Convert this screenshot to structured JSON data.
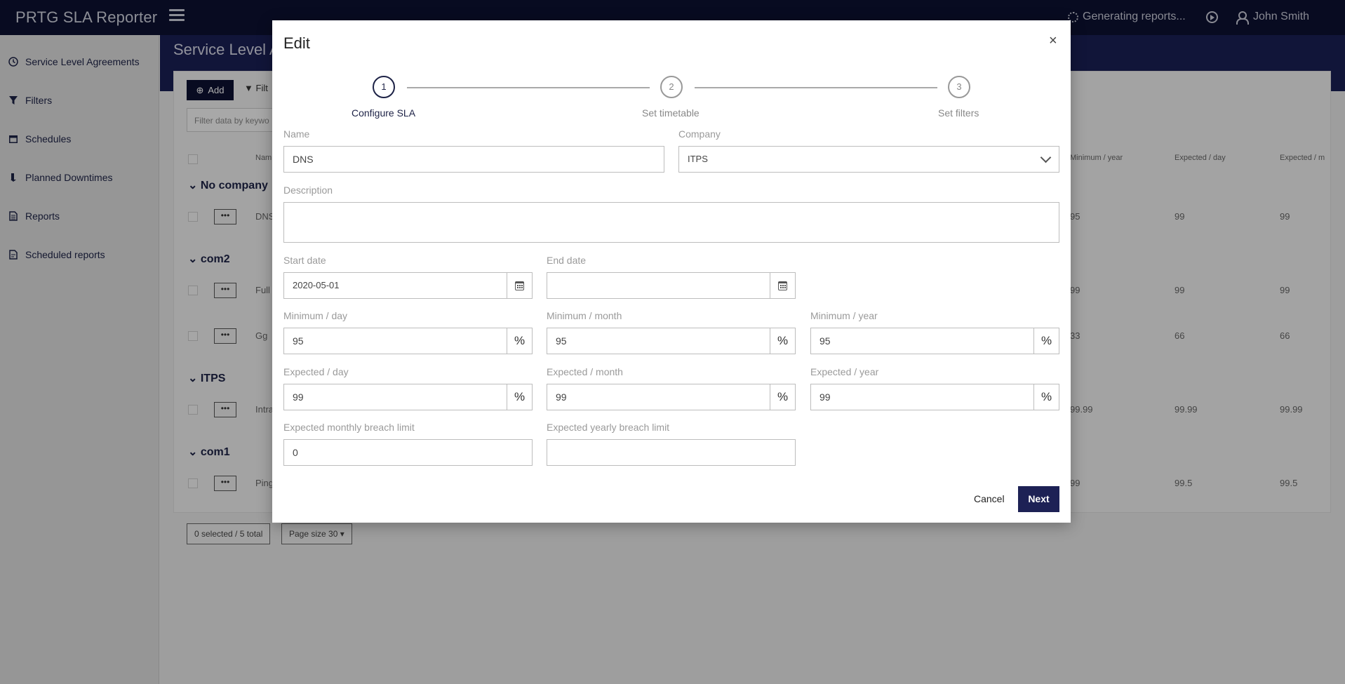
{
  "app": {
    "title": "PRTG SLA Reporter",
    "status": "Generating reports...",
    "user_name": "John Smith"
  },
  "sidebar": {
    "items": [
      {
        "label": "Service Level Agreements",
        "icon": "clock-icon"
      },
      {
        "label": "Filters",
        "icon": "filter-icon"
      },
      {
        "label": "Schedules",
        "icon": "calendar-icon"
      },
      {
        "label": "Planned Downtimes",
        "icon": "downtime-icon"
      },
      {
        "label": "Reports",
        "icon": "document-icon"
      },
      {
        "label": "Scheduled reports",
        "icon": "scheduled-document-icon"
      }
    ]
  },
  "background": {
    "page_title": "Service Level A",
    "add_label": "Add",
    "filter_label": "Filt",
    "keyword_placeholder": "Filter data by keywo",
    "col_name": "Nam",
    "columns_right": [
      "Minimum / year",
      "Expected / day",
      "Expected / m"
    ],
    "groups": [
      {
        "name": "No company",
        "rows": [
          {
            "name": "DNS",
            "cells": [
              "95",
              "99",
              "99"
            ]
          }
        ]
      },
      {
        "name": "com2",
        "rows": [
          {
            "name": "Full",
            "cells": [
              "99",
              "99",
              "99"
            ]
          },
          {
            "name": "Gg",
            "cells": [
              "33",
              "66",
              "66"
            ]
          }
        ]
      },
      {
        "name": "ITPS",
        "rows": [
          {
            "name": "Intra",
            "cells": [
              "99.99",
              "99.99",
              "99.99"
            ]
          }
        ]
      },
      {
        "name": "com1",
        "rows": [
          {
            "name": "Ping",
            "cells": [
              "99",
              "99.5",
              "99.5"
            ]
          }
        ]
      }
    ],
    "selected_count": "0 selected / 5 total",
    "page_size": "Page size 30"
  },
  "modal": {
    "title": "Edit",
    "close": "×",
    "steps": [
      {
        "number": "1",
        "label": "Configure SLA"
      },
      {
        "number": "2",
        "label": "Set timetable"
      },
      {
        "number": "3",
        "label": "Set filters"
      }
    ],
    "fields": {
      "name_label": "Name",
      "name_value": "DNS",
      "company_label": "Company",
      "company_value": "ITPS",
      "description_label": "Description",
      "description_value": "",
      "start_date_label": "Start date",
      "start_date_value": "2020-05-01",
      "end_date_label": "End date",
      "end_date_value": "",
      "min_day_label": "Minimum / day",
      "min_day_value": "95",
      "min_month_label": "Minimum / month",
      "min_month_value": "95",
      "min_year_label": "Minimum / year",
      "min_year_value": "95",
      "exp_day_label": "Expected / day",
      "exp_day_value": "99",
      "exp_month_label": "Expected / month",
      "exp_month_value": "99",
      "exp_year_label": "Expected / year",
      "exp_year_value": "99",
      "monthly_breach_label": "Expected monthly breach limit",
      "monthly_breach_value": "0",
      "yearly_breach_label": "Expected yearly breach limit",
      "yearly_breach_value": "",
      "percent_symbol": "%"
    },
    "cancel_label": "Cancel",
    "next_label": "Next"
  }
}
